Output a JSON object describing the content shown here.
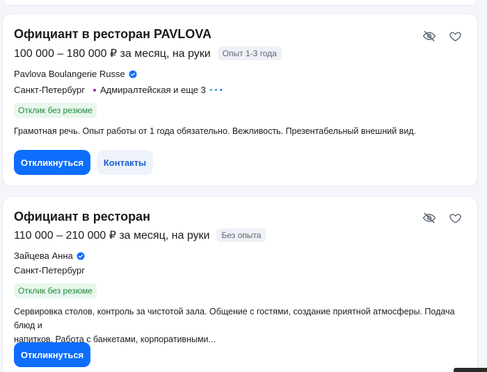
{
  "vacancies": [
    {
      "title": "Официант в ресторан PAVLOVA",
      "salary": "100 000 – 180 000 ₽ за месяц, на руки",
      "experience": "Опыт 1-3 года",
      "employer": "Pavlova Boulangerie Russe",
      "city": "Санкт-Петербург",
      "metro": "Адмиралтейская и еще 3",
      "badge": "Отклик без резюме",
      "description": "Грамотная речь. Опыт работы от 1 года обязательно. Вежливость. Презентабельный внешний вид.",
      "respond_label": "Откликнуться",
      "contacts_label": "Контакты"
    },
    {
      "title": "Официант в ресторан",
      "salary": "110 000 – 210 000 ₽ за месяц, на руки",
      "experience": "Без опыта",
      "employer": "Зайцева Анна",
      "city": "Санкт-Петербург",
      "badge": "Отклик без резюме",
      "description_line1": "Сервировка столов, контроль за чистотой зала. Общение с гостями, создание приятной атмосферы. Подача блюд и",
      "description_line2": "напитков. Работа с банкетами, корпоративными...",
      "respond_label": "Откликнуться"
    }
  ],
  "icons": {
    "hide": "eye-slash-icon",
    "favorite": "heart-icon",
    "verified": "verified-check-icon",
    "metro": "metro-dot-icon",
    "more": "more-dots-icon"
  },
  "colors": {
    "primary": "#0d6efd",
    "badge_green": "#1e8a3c",
    "metro_purple": "#9b2fae"
  }
}
